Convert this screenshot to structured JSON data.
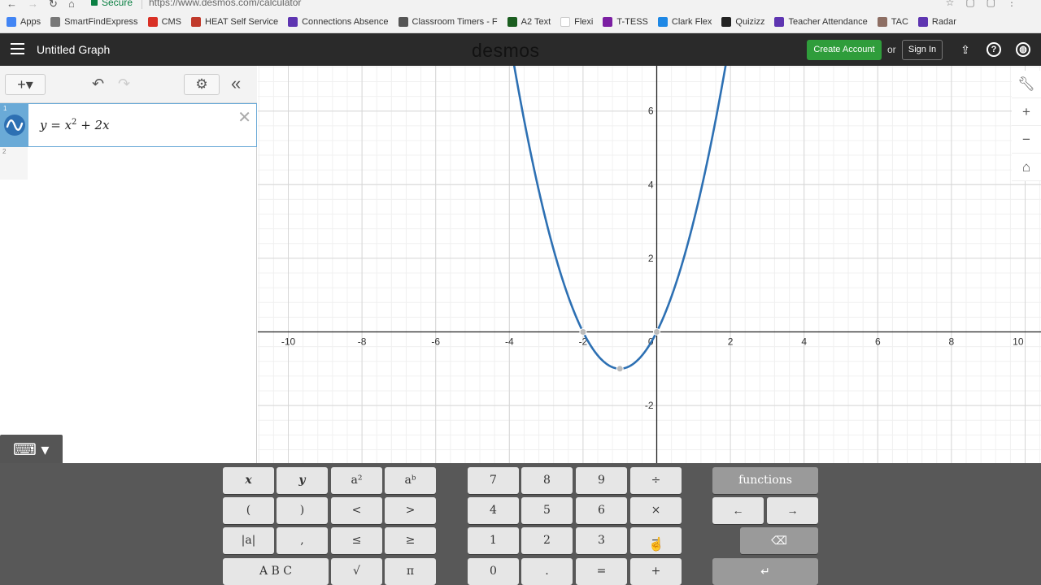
{
  "browser": {
    "secure_label": "Secure",
    "url": "https://www.desmos.com/calculator",
    "bookmarks": [
      {
        "label": "Apps",
        "color": "#4285f4"
      },
      {
        "label": "SmartFindExpress",
        "color": "#777777"
      },
      {
        "label": "CMS",
        "color": "#d93025"
      },
      {
        "label": "HEAT Self Service",
        "color": "#c0392b"
      },
      {
        "label": "Connections Absence",
        "color": "#5e35b1"
      },
      {
        "label": "Classroom Timers - F",
        "color": "#555555"
      },
      {
        "label": "A2 Text",
        "color": "#1b5e20"
      },
      {
        "label": "Flexi",
        "color": "#ffffff"
      },
      {
        "label": "T-TESS",
        "color": "#7b1fa2"
      },
      {
        "label": "Clark Flex",
        "color": "#1e88e5"
      },
      {
        "label": "Quizizz",
        "color": "#222222"
      },
      {
        "label": "Teacher Attendance",
        "color": "#5e35b1"
      },
      {
        "label": "TAC",
        "color": "#8d6e63"
      },
      {
        "label": "Radar",
        "color": "#5e35b1"
      }
    ]
  },
  "header": {
    "title": "Untitled Graph",
    "logo": "desmos",
    "create_account": "Create Account",
    "or": "or",
    "sign_in": "Sign In"
  },
  "expressions": [
    {
      "index": "1",
      "latex_parts": {
        "lhs": "y = x",
        "exp": "2",
        "rhs": " + 2x"
      },
      "color": "#2d70b3"
    },
    {
      "index": "2"
    }
  ],
  "graph": {
    "x_ticks": [
      "-10",
      "-8",
      "-6",
      "-4",
      "-2",
      "0",
      "2",
      "4",
      "6",
      "8",
      "10"
    ],
    "y_ticks": [
      "6",
      "4",
      "2",
      "-2"
    ],
    "function": "x^2 + 2x",
    "curve_color": "#2d70b3",
    "points": [
      {
        "x": -2,
        "y": 0
      },
      {
        "x": -1,
        "y": -1
      },
      {
        "x": 0,
        "y": 0
      }
    ]
  },
  "keypad": {
    "left": [
      [
        "x",
        "y",
        "a²",
        "aᵇ"
      ],
      [
        "(",
        ")",
        "<",
        ">"
      ],
      [
        "|a|",
        ",",
        "≤",
        "≥"
      ],
      [
        "A B C",
        "√",
        "π"
      ]
    ],
    "mid": [
      [
        "7",
        "8",
        "9",
        "÷"
      ],
      [
        "4",
        "5",
        "6",
        "×"
      ],
      [
        "1",
        "2",
        "3",
        "−"
      ],
      [
        "0",
        ".",
        "=",
        "+"
      ]
    ],
    "right": {
      "functions": "functions",
      "left_arrow": "←",
      "right_arrow": "→",
      "backspace": "⌫",
      "enter": "↵"
    }
  }
}
